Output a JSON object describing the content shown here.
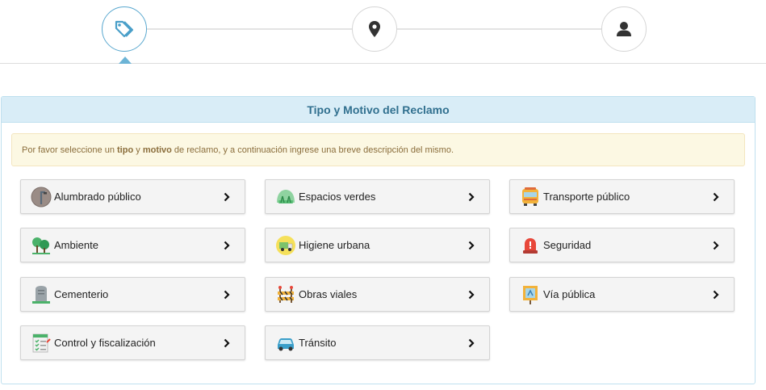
{
  "stepper": {
    "steps": [
      {
        "icon": "tags-icon",
        "active": true
      },
      {
        "icon": "map-marker-icon",
        "active": false
      },
      {
        "icon": "user-icon",
        "active": false
      }
    ]
  },
  "panel": {
    "title": "Tipo y Motivo del Reclamo",
    "alert": {
      "prefix": "Por favor seleccione un ",
      "bold1": "tipo",
      "mid": " y ",
      "bold2": "motivo",
      "suffix": " de reclamo, y a continuación ingrese una breve descripción del mismo."
    },
    "options": [
      {
        "label": "Alumbrado público",
        "icon": "street-light-icon"
      },
      {
        "label": "Espacios verdes",
        "icon": "park-icon"
      },
      {
        "label": "Transporte público",
        "icon": "bus-icon"
      },
      {
        "label": "Ambiente",
        "icon": "trees-icon"
      },
      {
        "label": "Higiene urbana",
        "icon": "garbage-truck-icon"
      },
      {
        "label": "Seguridad",
        "icon": "siren-icon"
      },
      {
        "label": "Cementerio",
        "icon": "tombstone-icon"
      },
      {
        "label": "Obras viales",
        "icon": "road-barrier-icon"
      },
      {
        "label": "Vía pública",
        "icon": "street-sign-icon"
      },
      {
        "label": "Control y fiscalización",
        "icon": "checklist-icon"
      },
      {
        "label": "Tránsito",
        "icon": "car-icon"
      }
    ]
  },
  "colors": {
    "heading_bg": "#d9edf7",
    "heading_text": "#31708f",
    "alert_bg": "#fcf8e3",
    "alert_text": "#8a6d3b",
    "active_step": "#5aa8cf"
  }
}
